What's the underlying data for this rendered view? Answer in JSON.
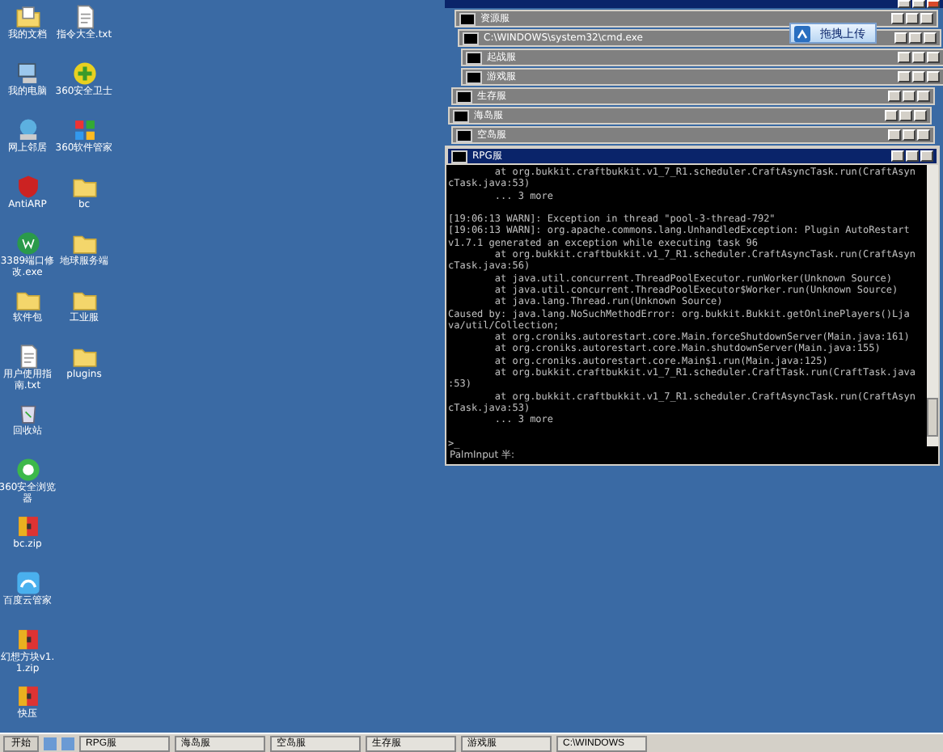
{
  "desktop_icons": [
    {
      "label": "我的文档",
      "kind": "docs"
    },
    {
      "label": "指令大全.txt",
      "kind": "text"
    },
    {
      "label": "我的电脑",
      "kind": "computer"
    },
    {
      "label": "360安全卫士",
      "kind": "shield"
    },
    {
      "label": "网上邻居",
      "kind": "network"
    },
    {
      "label": "360软件管家",
      "kind": "grid"
    },
    {
      "label": "AntiARP",
      "kind": "antivirus"
    },
    {
      "label": "bc",
      "kind": "folder"
    },
    {
      "label": "3389端口修改.exe",
      "kind": "wlogo"
    },
    {
      "label": "地球服务端",
      "kind": "folder"
    },
    {
      "label": "软件包",
      "kind": "folder"
    },
    {
      "label": "工业服",
      "kind": "folder"
    },
    {
      "label": "用户使用指南.txt",
      "kind": "text"
    },
    {
      "label": "plugins",
      "kind": "folder"
    },
    {
      "label": "回收站",
      "kind": "bin"
    },
    {
      "kind": "none"
    },
    {
      "label": "360安全浏览器",
      "kind": "browser"
    },
    {
      "kind": "none"
    },
    {
      "label": "bc.zip",
      "kind": "archive"
    },
    {
      "kind": "none"
    },
    {
      "label": "百度云管家",
      "kind": "cloud"
    },
    {
      "kind": "none"
    },
    {
      "label": "幻想方块v1.1.zip",
      "kind": "archive"
    },
    {
      "kind": "none"
    },
    {
      "label": "快压",
      "kind": "archive"
    }
  ],
  "windows": [
    {
      "title": "资源服"
    },
    {
      "title": "C:\\WINDOWS\\system32\\cmd.exe"
    },
    {
      "title": "起战服"
    },
    {
      "title": "游戏服"
    },
    {
      "title": "生存服"
    },
    {
      "title": "海岛服"
    },
    {
      "title": "空岛服"
    }
  ],
  "upload_button": {
    "label": "拖拽上传"
  },
  "console": {
    "title": "RPG服",
    "line_groups": [
      [
        "        at org.bukkit.craftbukkit.v1_7_R1.scheduler.CraftAsyncTask.run(CraftAsyn",
        "cTask.java:53)",
        "        ... 3 more"
      ],
      [
        "[19:06:13 WARN]: Exception in thread \"pool-3-thread-792\"",
        "[19:06:13 WARN]: org.apache.commons.lang.UnhandledException: Plugin AutoRestart",
        "v1.7.1 generated an exception while executing task 96",
        "        at org.bukkit.craftbukkit.v1_7_R1.scheduler.CraftAsyncTask.run(CraftAsyn",
        "cTask.java:56)",
        "        at java.util.concurrent.ThreadPoolExecutor.runWorker(Unknown Source)",
        "        at java.util.concurrent.ThreadPoolExecutor$Worker.run(Unknown Source)",
        "        at java.lang.Thread.run(Unknown Source)",
        "Caused by: java.lang.NoSuchMethodError: org.bukkit.Bukkit.getOnlinePlayers()Lja",
        "va/util/Collection;",
        "        at org.croniks.autorestart.core.Main.forceShutdownServer(Main.java:161)",
        "        at org.croniks.autorestart.core.Main.shutdownServer(Main.java:155)",
        "        at org.croniks.autorestart.core.Main$1.run(Main.java:125)",
        "        at org.bukkit.craftbukkit.v1_7_R1.scheduler.CraftTask.run(CraftTask.java",
        ":53)",
        "        at org.bukkit.craftbukkit.v1_7_R1.scheduler.CraftAsyncTask.run(CraftAsyn",
        "cTask.java:53)",
        "        ... 3 more"
      ],
      [
        ">_"
      ]
    ],
    "ime_status": "PalmInput 半:"
  },
  "taskbar": {
    "start": "开始",
    "items": [
      "RPG服",
      "海岛服",
      "空岛服",
      "生存服",
      "游戏服",
      "C:\\WINDOWS"
    ]
  }
}
